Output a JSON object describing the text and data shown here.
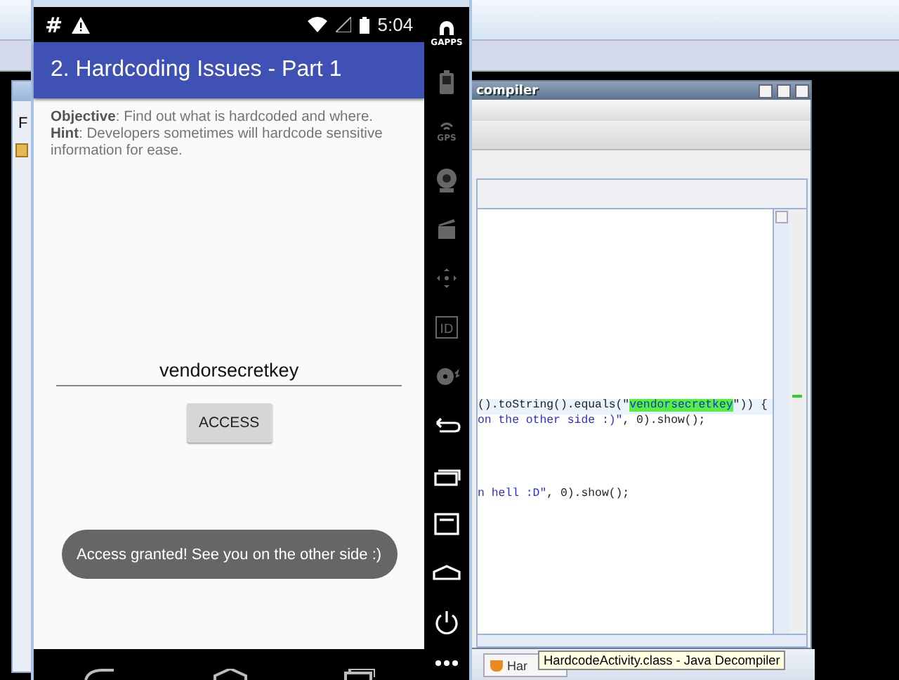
{
  "back_window": {
    "menu_letter": "F"
  },
  "decompiler": {
    "title": "compiler",
    "code_lines": [
      {
        "selected": true,
        "parts": [
          {
            "kind": "code",
            "text": "().toString().equals(\""
          },
          {
            "kind": "match",
            "text": "vendorsecretkey"
          },
          {
            "kind": "code",
            "text": "\")) {"
          }
        ]
      },
      {
        "selected": false,
        "parts": [
          {
            "kind": "string",
            "text": "on the other side :)\""
          },
          {
            "kind": "code",
            "text": ", 0).show();"
          }
        ]
      },
      {
        "selected": false,
        "parts": [
          {
            "kind": "string",
            "text": "n hell :D\""
          },
          {
            "kind": "code",
            "text": ", 0).show();"
          }
        ]
      }
    ]
  },
  "taskbar": {
    "button_label": "Har",
    "tooltip": "HardcodeActivity.class - Java Decompiler"
  },
  "emulator": {
    "status_bar": {
      "left_symbol": "#",
      "time": "5:04"
    },
    "app_bar": {
      "title": "2. Hardcoding Issues - Part 1"
    },
    "description": "**Objective**: Find out what is hardcoded and where.\n **Hint**: Developers sometimes will hardcode sensitive information for ease.",
    "input": {
      "value": "vendorsecretkey"
    },
    "button": "ACCESS",
    "toast": "Access granted! See you on the other side :)",
    "side_toolbar": {
      "gapps_label": "GAPPS",
      "gps_label": "GPS",
      "id_label": "ID"
    }
  }
}
